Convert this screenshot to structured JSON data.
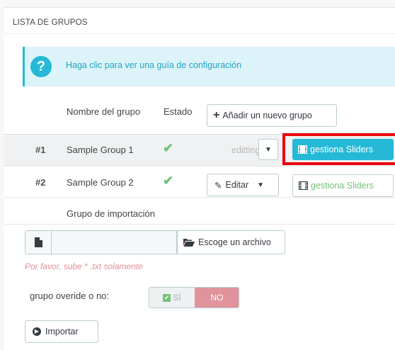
{
  "panel": {
    "title": "LISTA DE GRUPOS"
  },
  "guide": {
    "icon": "question-icon",
    "icon_glyph": "?",
    "text": "Haga clic para ver una guía de configuración"
  },
  "table": {
    "headers": {
      "name": "Nombre del grupo",
      "status": "Estado"
    },
    "add_button": "Añadir un nuevo grupo",
    "rows": [
      {
        "id": "#1",
        "name": "Sample Group 1",
        "status_icon": "check-icon",
        "edit_label": "editting",
        "sliders_label": "gestiona Sliders"
      },
      {
        "id": "#2",
        "name": "Sample Group 2",
        "status_icon": "check-icon",
        "edit_label": "Editar",
        "sliders_label": "gestiona Sliders"
      }
    ]
  },
  "import": {
    "label": "Grupo de importación",
    "file_button": "Escoge un archivo",
    "hint": "Por favor, sube * .txt solamente",
    "override_label": "grupo overide o no:",
    "switch": {
      "yes": "SÍ",
      "no": "NO",
      "selected": "NO"
    },
    "import_button": "Importar"
  },
  "colors": {
    "accent": "#25b9d7",
    "success": "#72c279",
    "highlight": "#e8000e",
    "no": "#e0939b"
  }
}
